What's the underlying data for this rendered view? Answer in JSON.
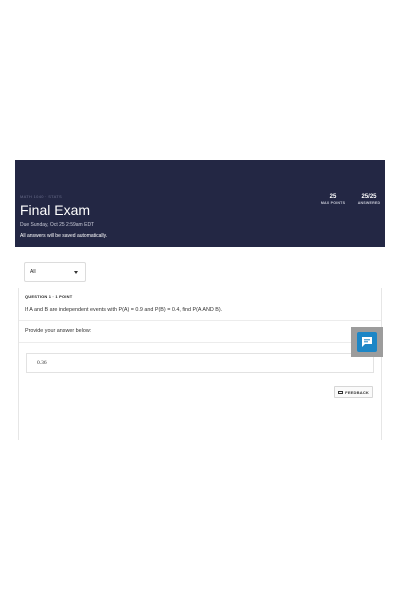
{
  "banner": {
    "breadcrumb": "MATH 1040 · STATS",
    "title": "Final Exam",
    "due": "Due Sunday, Oct 25 2:59am EDT",
    "autosave": "All answers will be saved automatically.",
    "stats": [
      {
        "value": "25",
        "label": "MAX POINTS"
      },
      {
        "value": "25/25",
        "label": "ANSWERED"
      }
    ],
    "bg_color": "#232744"
  },
  "filter": {
    "selected": "All"
  },
  "question": {
    "header": "QUESTION 1 · 1 POINT",
    "text": "If A and B are independent events with P(A) = 0.9 and P(B) = 0.4, find P(A AND B).",
    "prompt": "Provide your answer below:",
    "answer": "0.36",
    "feedback_label": "FEEDBACK"
  },
  "chat": {
    "icon": "chat-icon",
    "color": "#1c86c6"
  }
}
